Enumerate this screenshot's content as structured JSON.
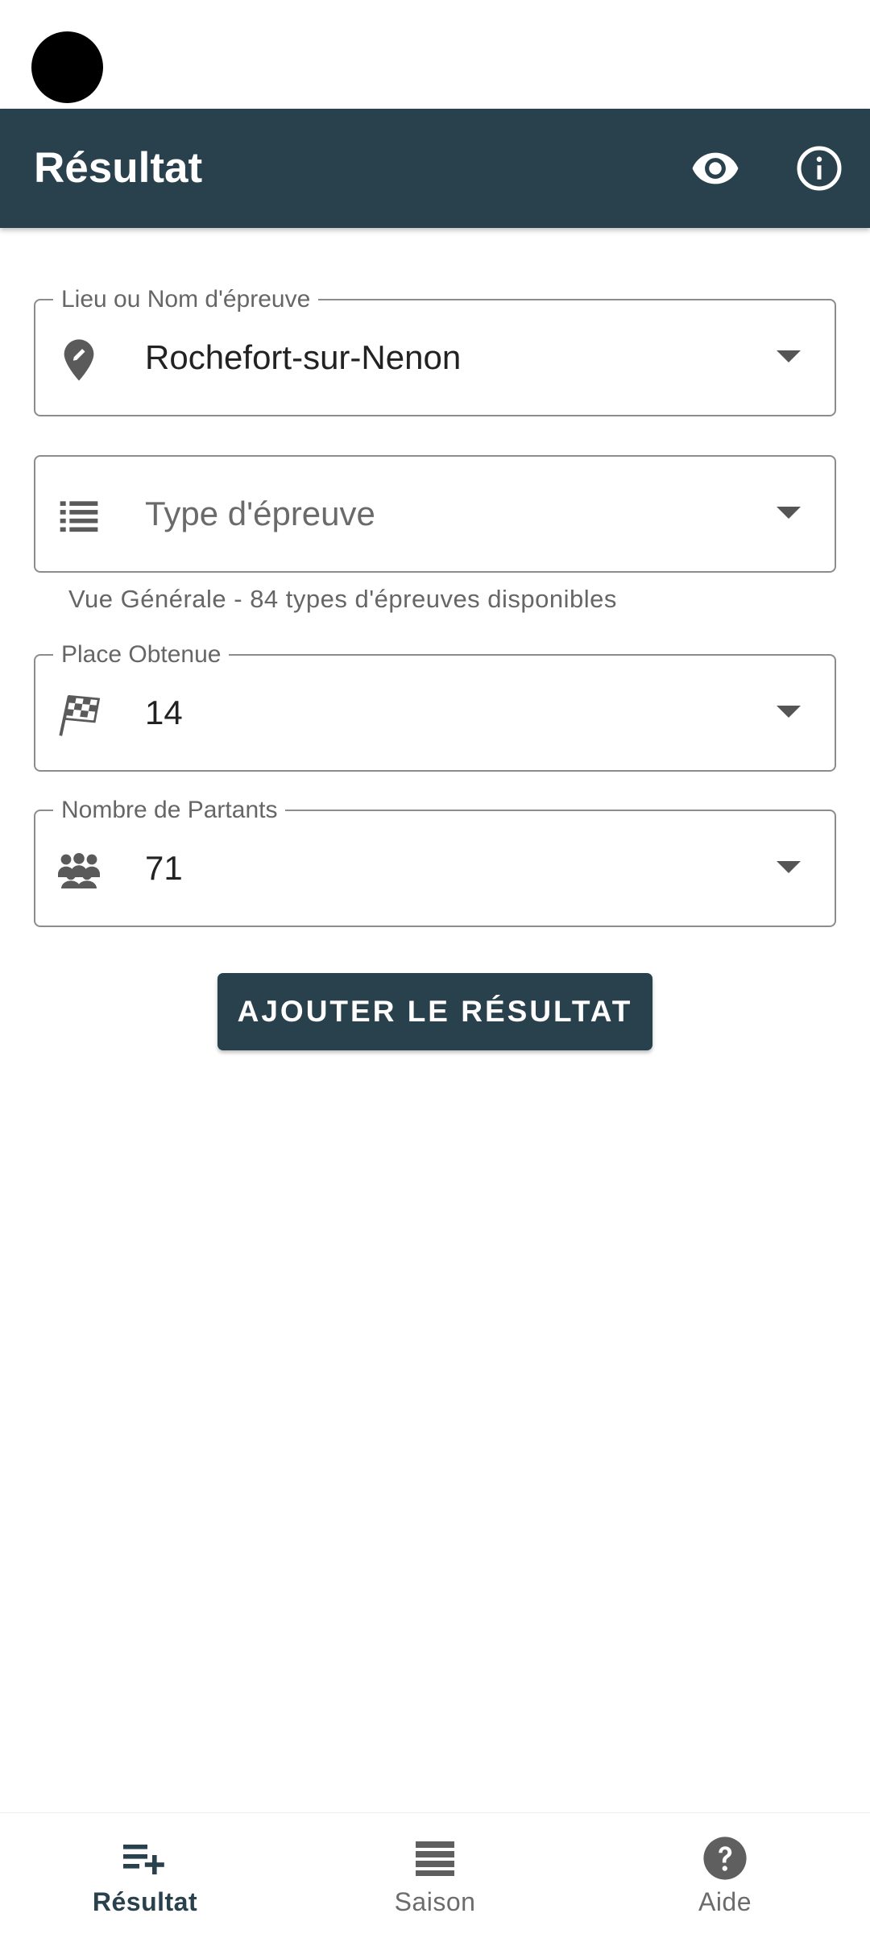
{
  "app_bar": {
    "title": "Résultat",
    "actions": [
      {
        "icon": "eye-icon"
      },
      {
        "icon": "info-icon"
      }
    ]
  },
  "form": {
    "location": {
      "label": "Lieu ou Nom d'épreuve",
      "value": "Rochefort-sur-Nenon",
      "icon": "pen-location-icon"
    },
    "event_type": {
      "placeholder": "Type d'épreuve",
      "value": "",
      "icon": "list-icon",
      "helper": "Vue Générale - 84 types d'épreuves disponibles"
    },
    "place": {
      "label": "Place Obtenue",
      "value": "14",
      "icon": "checkered-flag-icon"
    },
    "participants": {
      "label": "Nombre de Partants",
      "value": "71",
      "icon": "people-group-icon"
    },
    "submit_label": "AJOUTER LE RÉSULTAT"
  },
  "bottom_nav": {
    "items": [
      {
        "label": "Résultat",
        "icon": "playlist-add-icon",
        "active": true
      },
      {
        "label": "Saison",
        "icon": "list-bars-icon",
        "active": false
      },
      {
        "label": "Aide",
        "icon": "help-circle-icon",
        "active": false
      }
    ]
  },
  "colors": {
    "primary": "#29414c",
    "text": "#222222",
    "muted": "#666666",
    "outline": "#8c8c8c"
  }
}
